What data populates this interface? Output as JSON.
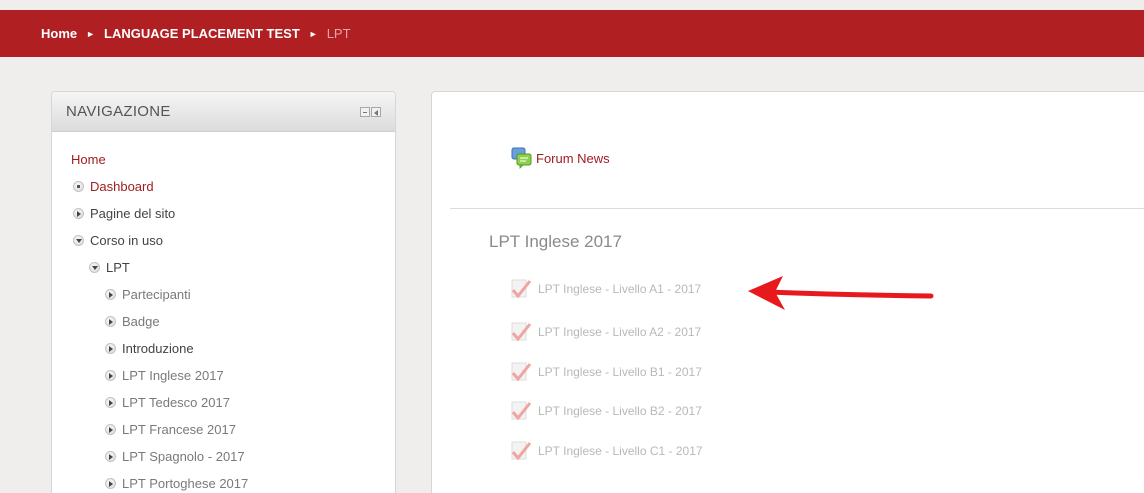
{
  "breadcrumb": {
    "home": "Home",
    "section": "LANGUAGE PLACEMENT TEST",
    "current": "LPT",
    "separator": "►"
  },
  "navigation": {
    "title": "NAVIGAZIONE",
    "items": [
      {
        "label": "Home"
      },
      {
        "label": "Dashboard"
      },
      {
        "label": "Pagine del sito"
      },
      {
        "label": "Corso in uso"
      },
      {
        "label": "LPT"
      },
      {
        "label": "Partecipanti"
      },
      {
        "label": "Badge"
      },
      {
        "label": "Introduzione"
      },
      {
        "label": "LPT Inglese 2017"
      },
      {
        "label": "LPT Tedesco 2017"
      },
      {
        "label": "LPT Francese 2017"
      },
      {
        "label": "LPT Spagnolo - 2017"
      },
      {
        "label": "LPT Portoghese 2017"
      }
    ]
  },
  "main": {
    "forum_label": "Forum News",
    "section_title": "LPT Inglese 2017",
    "activities": [
      {
        "label": "LPT Inglese - Livello A1 - 2017"
      },
      {
        "label": "LPT Inglese - Livello A2 - 2017"
      },
      {
        "label": "LPT Inglese - Livello B1 - 2017"
      },
      {
        "label": "LPT Inglese - Livello B2 - 2017"
      },
      {
        "label": "LPT Inglese - Livello C1 - 2017"
      }
    ]
  },
  "colors": {
    "brand_red": "#b01f22",
    "link_red": "#9e1b1e",
    "annotation_arrow": "#e8191c"
  }
}
